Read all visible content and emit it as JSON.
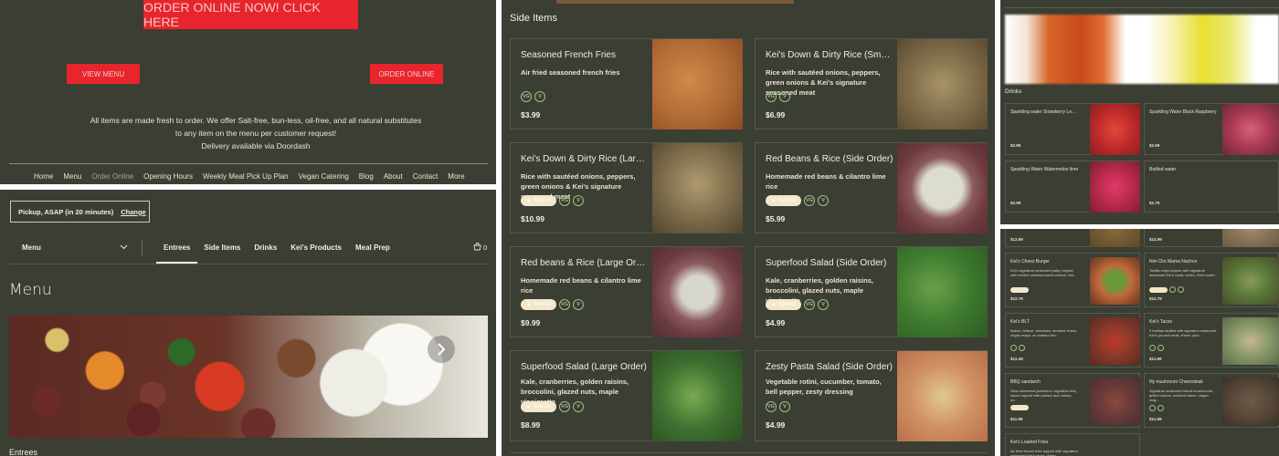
{
  "colors": {
    "panel_bg": "#3b3e33",
    "accent_red": "#e8242c",
    "badge_green": "#9fc089",
    "badge_cream": "#f3e6c9"
  },
  "hero": {
    "order_banner": "ORDER ONLINE NOW! CLICK HERE",
    "view_menu": "VIEW MENU",
    "order_online": "ORDER ONLINE",
    "info_line1": "All items are made fresh to order.  We offer Salt-free, bun-less, oil-free, and all natural substitutes",
    "info_line2": "to any item on the menu per customer request!",
    "info_line3": "Delivery available via Doordash"
  },
  "nav": [
    "Home",
    "Menu",
    "Order Online",
    "Opening Hours",
    "Weekly Meal Pick Up Plan",
    "Vegan Catering",
    "Blog",
    "About",
    "Contact",
    "More"
  ],
  "order": {
    "pickup_text": "Pickup, ASAP (in 20 minutes)",
    "change_label": "Change",
    "menu_dropdown": "Menu",
    "tabs": [
      "Entrees",
      "Side Items",
      "Drinks",
      "Kei's Products",
      "Meal Prep"
    ],
    "cart_count": "0",
    "heading": "Menu",
    "section_label": "Entrees"
  },
  "side_items": {
    "heading": "Side Items",
    "special_label": "Special",
    "vg_label": "VG",
    "v_label": "V",
    "items": [
      {
        "name": "Seasoned French Fries",
        "desc": "Air fried seasoned french fries",
        "price": "$3.99"
      },
      {
        "name": "Kei's Down & Dirty Rice (Small ...",
        "desc": "Rice with sautéed onions, peppers, green onions & Kei's signature seasoned meat",
        "price": "$6.99"
      },
      {
        "name": "Kei's Down & Dirty Rice (Large ...",
        "desc": "Rice with sautéed onions, peppers, green onions & Kei's signature seasoned meat",
        "price": "$10.99"
      },
      {
        "name": "Red Beans & Rice (Side Order)",
        "desc": "Homemade red beans & cilantro lime rice",
        "price": "$5.99"
      },
      {
        "name": "Red beans & Rice (Large Order)",
        "desc": "Homemade red beans & cilantro lime rice",
        "price": "$9.99"
      },
      {
        "name": "Superfood Salad (Side Order)",
        "desc": "Kale, cranberries, golden raisins, broccolini, glazed nuts, maple vinaigrette",
        "price": "$4.99"
      },
      {
        "name": "Superfood Salad (Large Order)",
        "desc": "Kale, cranberries, golden raisins, broccolini, glazed nuts, maple vinaigrette",
        "price": "$8.99"
      },
      {
        "name": "Zesty Pasta Salad (Side Order)",
        "desc": "Vegetable rotini, cucumber, tomato, bell pepper, zesty dressing",
        "price": "$4.99"
      }
    ]
  },
  "drinks": {
    "heading": "Drinks",
    "items": [
      {
        "name": "Sparkling water Strawberry Lem...",
        "price": "$2.99"
      },
      {
        "name": "Sparkling Water Black Raspberry",
        "price": "$2.99"
      },
      {
        "name": "Sparkling Water Watermelon lime",
        "price": "$2.99"
      },
      {
        "name": "Bottled water",
        "price": "$1.79"
      }
    ]
  },
  "entrees_small": {
    "top_prices": [
      "$12.99",
      "$14.99"
    ],
    "items": [
      {
        "name": "Kei's Cheez Burger",
        "desc": "Kei's signature seasoned patty, topped with melted cashew-based cheeze, lett...",
        "price": "$12.79"
      },
      {
        "name": "Not-Cho Mama Nachos",
        "desc": "Tortilla chips topped with signature seasoned Kei's meat, cheez, Kei's south...",
        "price": "$12.79"
      },
      {
        "name": "Kei's BLT",
        "desc": "Bakon, lettuce, tomatoes, smoked cheez, vegan mayo, on toasted bun",
        "price": "$12.49"
      },
      {
        "name": "Kei's Tacos",
        "desc": "3 tortillas stuffed with signature seasoned Kei's ground meat, cheez, pico...",
        "price": "$11.99"
      },
      {
        "name": "BBQ sandwich",
        "desc": "Slow simmered jackfruit in signature bbq sauce topped with pickles and onions, on...",
        "price": "$11.99"
      },
      {
        "name": "Illy mushroom Cheezsteak",
        "desc": "Signature seasoned sliced mushrooms, grilled onions, smoked cheez, vegan may...",
        "price": "$11.99"
      },
      {
        "name": "Kei's Loaded Fries",
        "desc": "Air fried french fries topped with signature seasoned Kei's meat, cheez...",
        "price": ""
      }
    ]
  }
}
